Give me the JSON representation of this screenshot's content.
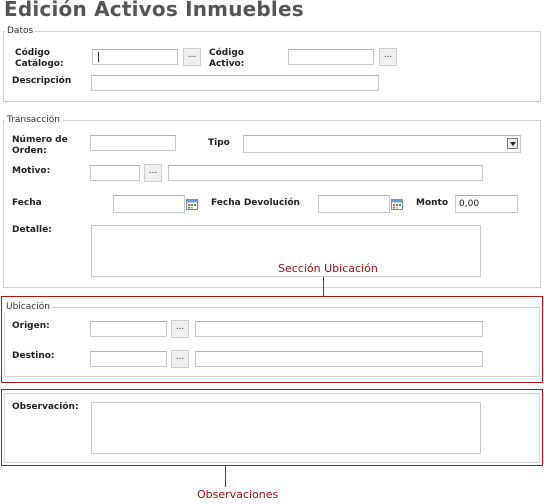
{
  "page": {
    "title": "Edición Activos Inmuebles"
  },
  "datos": {
    "legend": "Datos",
    "codigo_catalogo_label": "Código Catálogo:",
    "codigo_catalogo_value": "",
    "codigo_activo_label": "Código Activo:",
    "codigo_activo_value": "",
    "descripcion_label": "Descripción",
    "descripcion_value": "",
    "lookup_label": "..."
  },
  "transaccion": {
    "legend": "Transacción",
    "numero_orden_label": "Número de Orden:",
    "numero_orden_value": "",
    "tipo_label": "Tipo",
    "tipo_selected": "",
    "motivo_label": "Motivo:",
    "motivo_code": "",
    "motivo_desc": "",
    "fecha_label": "Fecha",
    "fecha_value": "",
    "fecha_devolucion_label": "Fecha Devolución",
    "fecha_devolucion_value": "",
    "monto_label": "Monto",
    "monto_value": "0,00",
    "detalle_label": "Detalle:",
    "detalle_value": "",
    "lookup_label": "..."
  },
  "ubicacion": {
    "legend": "Ubicación",
    "origen_label": "Origen:",
    "origen_code": "",
    "origen_desc": "",
    "destino_label": "Destino:",
    "destino_code": "",
    "destino_desc": "",
    "lookup_label": "..."
  },
  "observacion": {
    "label": "Observación:",
    "value": ""
  },
  "annotations": {
    "seccion_ubicacion": "Sección Ubicación",
    "observaciones": "Observaciones"
  },
  "colors": {
    "annotation_red": "#b01818",
    "fieldset_border": "#d2d2d2",
    "title_gray": "#555555"
  },
  "icons": [
    "calendar-icon",
    "dropdown-arrow-icon",
    "ellipsis-lookup-icon"
  ]
}
